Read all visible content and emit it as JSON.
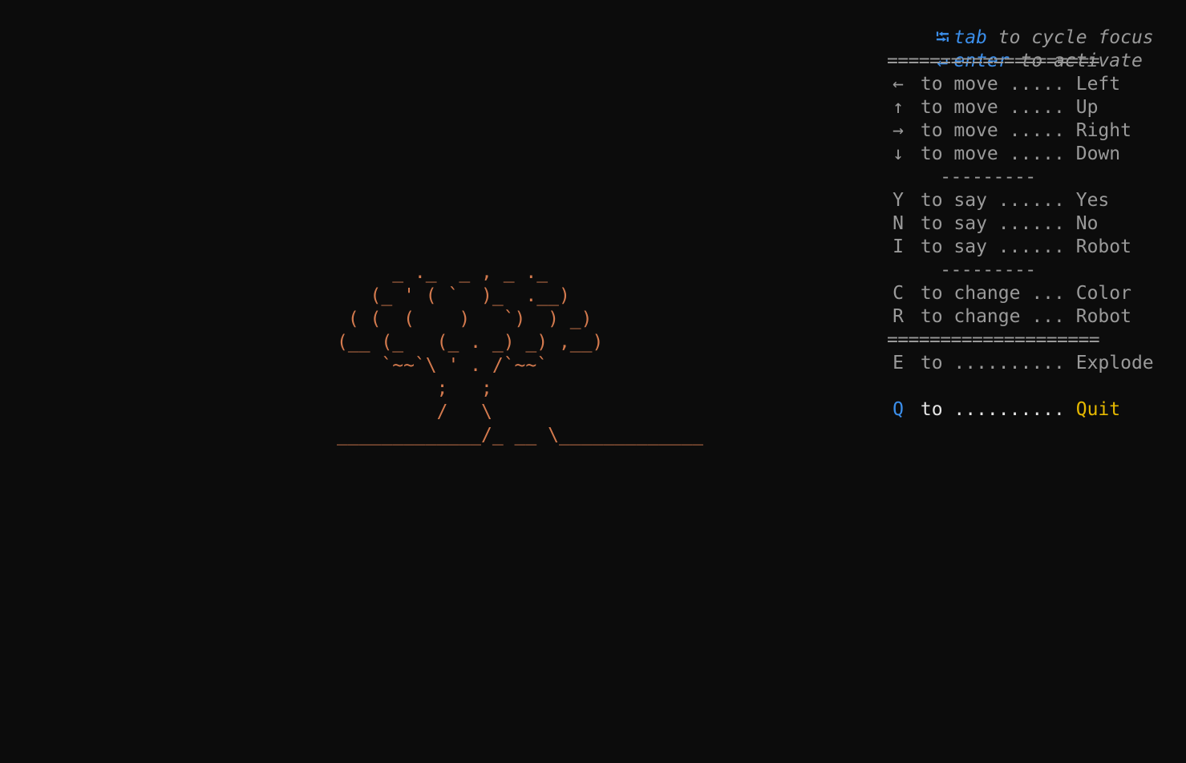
{
  "art": {
    "color": "#d47a4e",
    "lines": [
      "     _ ._  _ , _ ._",
      "   (_ ' ( `  )_  .__)",
      " ( (  (    )   `)  ) _)",
      "(__ (_   (_ . _) _) ,__)",
      "    `~~`\\ ' . /`~~`",
      "         ;   ;",
      "         /   \\",
      "_____________/_ __ \\_____________"
    ]
  },
  "help": {
    "colors": {
      "accent": "#3b8eea",
      "text": "#9a9a9a",
      "highlight": "#e5e5e5",
      "quit": "#e5b800"
    },
    "focus": [
      {
        "icon": "tab-icon",
        "glyph": "⭾",
        "key": "tab",
        "text": " to cycle focus"
      },
      {
        "icon": "enter-icon",
        "glyph": "↵",
        "key": "enter",
        "text": " to activate"
      }
    ],
    "separator_major": "====================",
    "separator_minor": "     ---------",
    "move": [
      {
        "key": "←",
        "text": " to move ..... ",
        "action": "Left"
      },
      {
        "key": "↑",
        "text": " to move ..... ",
        "action": "Up"
      },
      {
        "key": "→",
        "text": " to move ..... ",
        "action": "Right"
      },
      {
        "key": "↓",
        "text": " to move ..... ",
        "action": "Down"
      }
    ],
    "say": [
      {
        "key": "Y",
        "text": " to say ...... ",
        "action": "Yes"
      },
      {
        "key": "N",
        "text": " to say ...... ",
        "action": "No"
      },
      {
        "key": "I",
        "text": " to say ...... ",
        "action": "Robot"
      }
    ],
    "change": [
      {
        "key": "C",
        "text": " to change ... ",
        "action": "Color"
      },
      {
        "key": "R",
        "text": " to change ... ",
        "action": "Robot"
      }
    ],
    "explode": {
      "key": "E",
      "text": " to .......... ",
      "action": "Explode"
    },
    "quit": {
      "key": "Q",
      "to": " to",
      "dots": " .......... ",
      "action": "Quit"
    }
  }
}
